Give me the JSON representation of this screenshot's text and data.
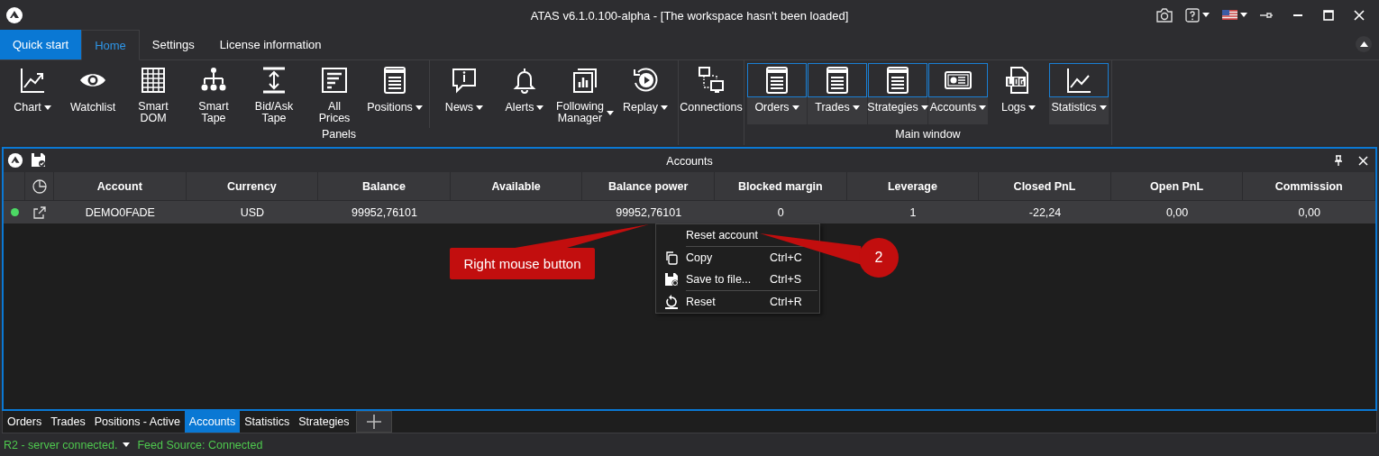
{
  "window": {
    "title": "ATAS v6.1.0.100-alpha - [The workspace hasn't been loaded]"
  },
  "ribbon_tabs": [
    {
      "label": "Quick start",
      "kind": "start",
      "selected": false
    },
    {
      "label": "Home",
      "kind": "tab",
      "selected": true
    },
    {
      "label": "Settings",
      "kind": "tab",
      "selected": false
    },
    {
      "label": "License information",
      "kind": "tab",
      "selected": false
    }
  ],
  "ribbon_groups": [
    {
      "label": "Panels",
      "sections": [
        [
          {
            "label": "Chart",
            "dropdown": true,
            "highlighted": false
          },
          {
            "label": "Watchlist",
            "dropdown": false,
            "highlighted": false
          },
          {
            "label": "Smart DOM",
            "dropdown": false,
            "highlighted": false
          },
          {
            "label": "Smart Tape",
            "dropdown": false,
            "highlighted": false
          },
          {
            "label": "Bid/Ask Tape",
            "dropdown": false,
            "highlighted": false
          },
          {
            "label": "All Prices",
            "dropdown": false,
            "highlighted": false
          },
          {
            "label": "Positions",
            "dropdown": true,
            "highlighted": false
          }
        ],
        [
          {
            "label": "News",
            "dropdown": true,
            "highlighted": false
          },
          {
            "label": "Alerts",
            "dropdown": true,
            "highlighted": false
          },
          {
            "label": "Following Manager",
            "dropdown": true,
            "highlighted": false
          },
          {
            "label": "Replay",
            "dropdown": true,
            "highlighted": false
          }
        ]
      ]
    },
    {
      "sections": [
        [
          {
            "label": "Connections",
            "dropdown": false,
            "highlighted": false
          }
        ]
      ]
    },
    {
      "label": "Main window",
      "sections": [
        [
          {
            "label": "Orders",
            "dropdown": true,
            "highlighted": true
          },
          {
            "label": "Trades",
            "dropdown": true,
            "highlighted": true
          },
          {
            "label": "Strategies",
            "dropdown": true,
            "highlighted": true
          },
          {
            "label": "Accounts",
            "dropdown": true,
            "highlighted": true
          },
          {
            "label": "Logs",
            "dropdown": true,
            "highlighted": false
          },
          {
            "label": "Statistics",
            "dropdown": true,
            "highlighted": true
          }
        ]
      ]
    }
  ],
  "panel": {
    "title": "Accounts",
    "columns": [
      "Account",
      "Currency",
      "Balance",
      "Available",
      "Balance power",
      "Blocked margin",
      "Leverage",
      "Closed PnL",
      "Open PnL",
      "Commission"
    ],
    "rows": [
      {
        "color": "#4cd964",
        "cells": [
          "DEMO0FADE",
          "USD",
          "99952,76101",
          "",
          "99952,76101",
          "0",
          "1",
          "-22,24",
          "0,00",
          "0,00"
        ]
      }
    ]
  },
  "context_menu": [
    {
      "kind": "heading",
      "label": "Reset account"
    },
    {
      "kind": "separator"
    },
    {
      "kind": "item",
      "label": "Copy",
      "shortcut": "Ctrl+C"
    },
    {
      "kind": "item",
      "label": "Save to file...",
      "shortcut": "Ctrl+S"
    },
    {
      "kind": "separator"
    },
    {
      "kind": "item",
      "label": "Reset",
      "shortcut": "Ctrl+R"
    }
  ],
  "callouts": [
    {
      "kind": "label",
      "text": "Right mouse button"
    },
    {
      "kind": "number",
      "text": "2"
    }
  ],
  "document_tabs": [
    {
      "label": "Orders",
      "selected": false
    },
    {
      "label": "Trades",
      "selected": false
    },
    {
      "label": "Positions - Active",
      "selected": false
    },
    {
      "label": "Accounts",
      "selected": true
    },
    {
      "label": "Statistics",
      "selected": false
    },
    {
      "label": "Strategies",
      "selected": false
    }
  ],
  "status_bar": [
    {
      "text": "R2 - server connected.",
      "dropdown": true
    },
    {
      "text": "Feed Source: Connected",
      "dropdown": false
    }
  ]
}
